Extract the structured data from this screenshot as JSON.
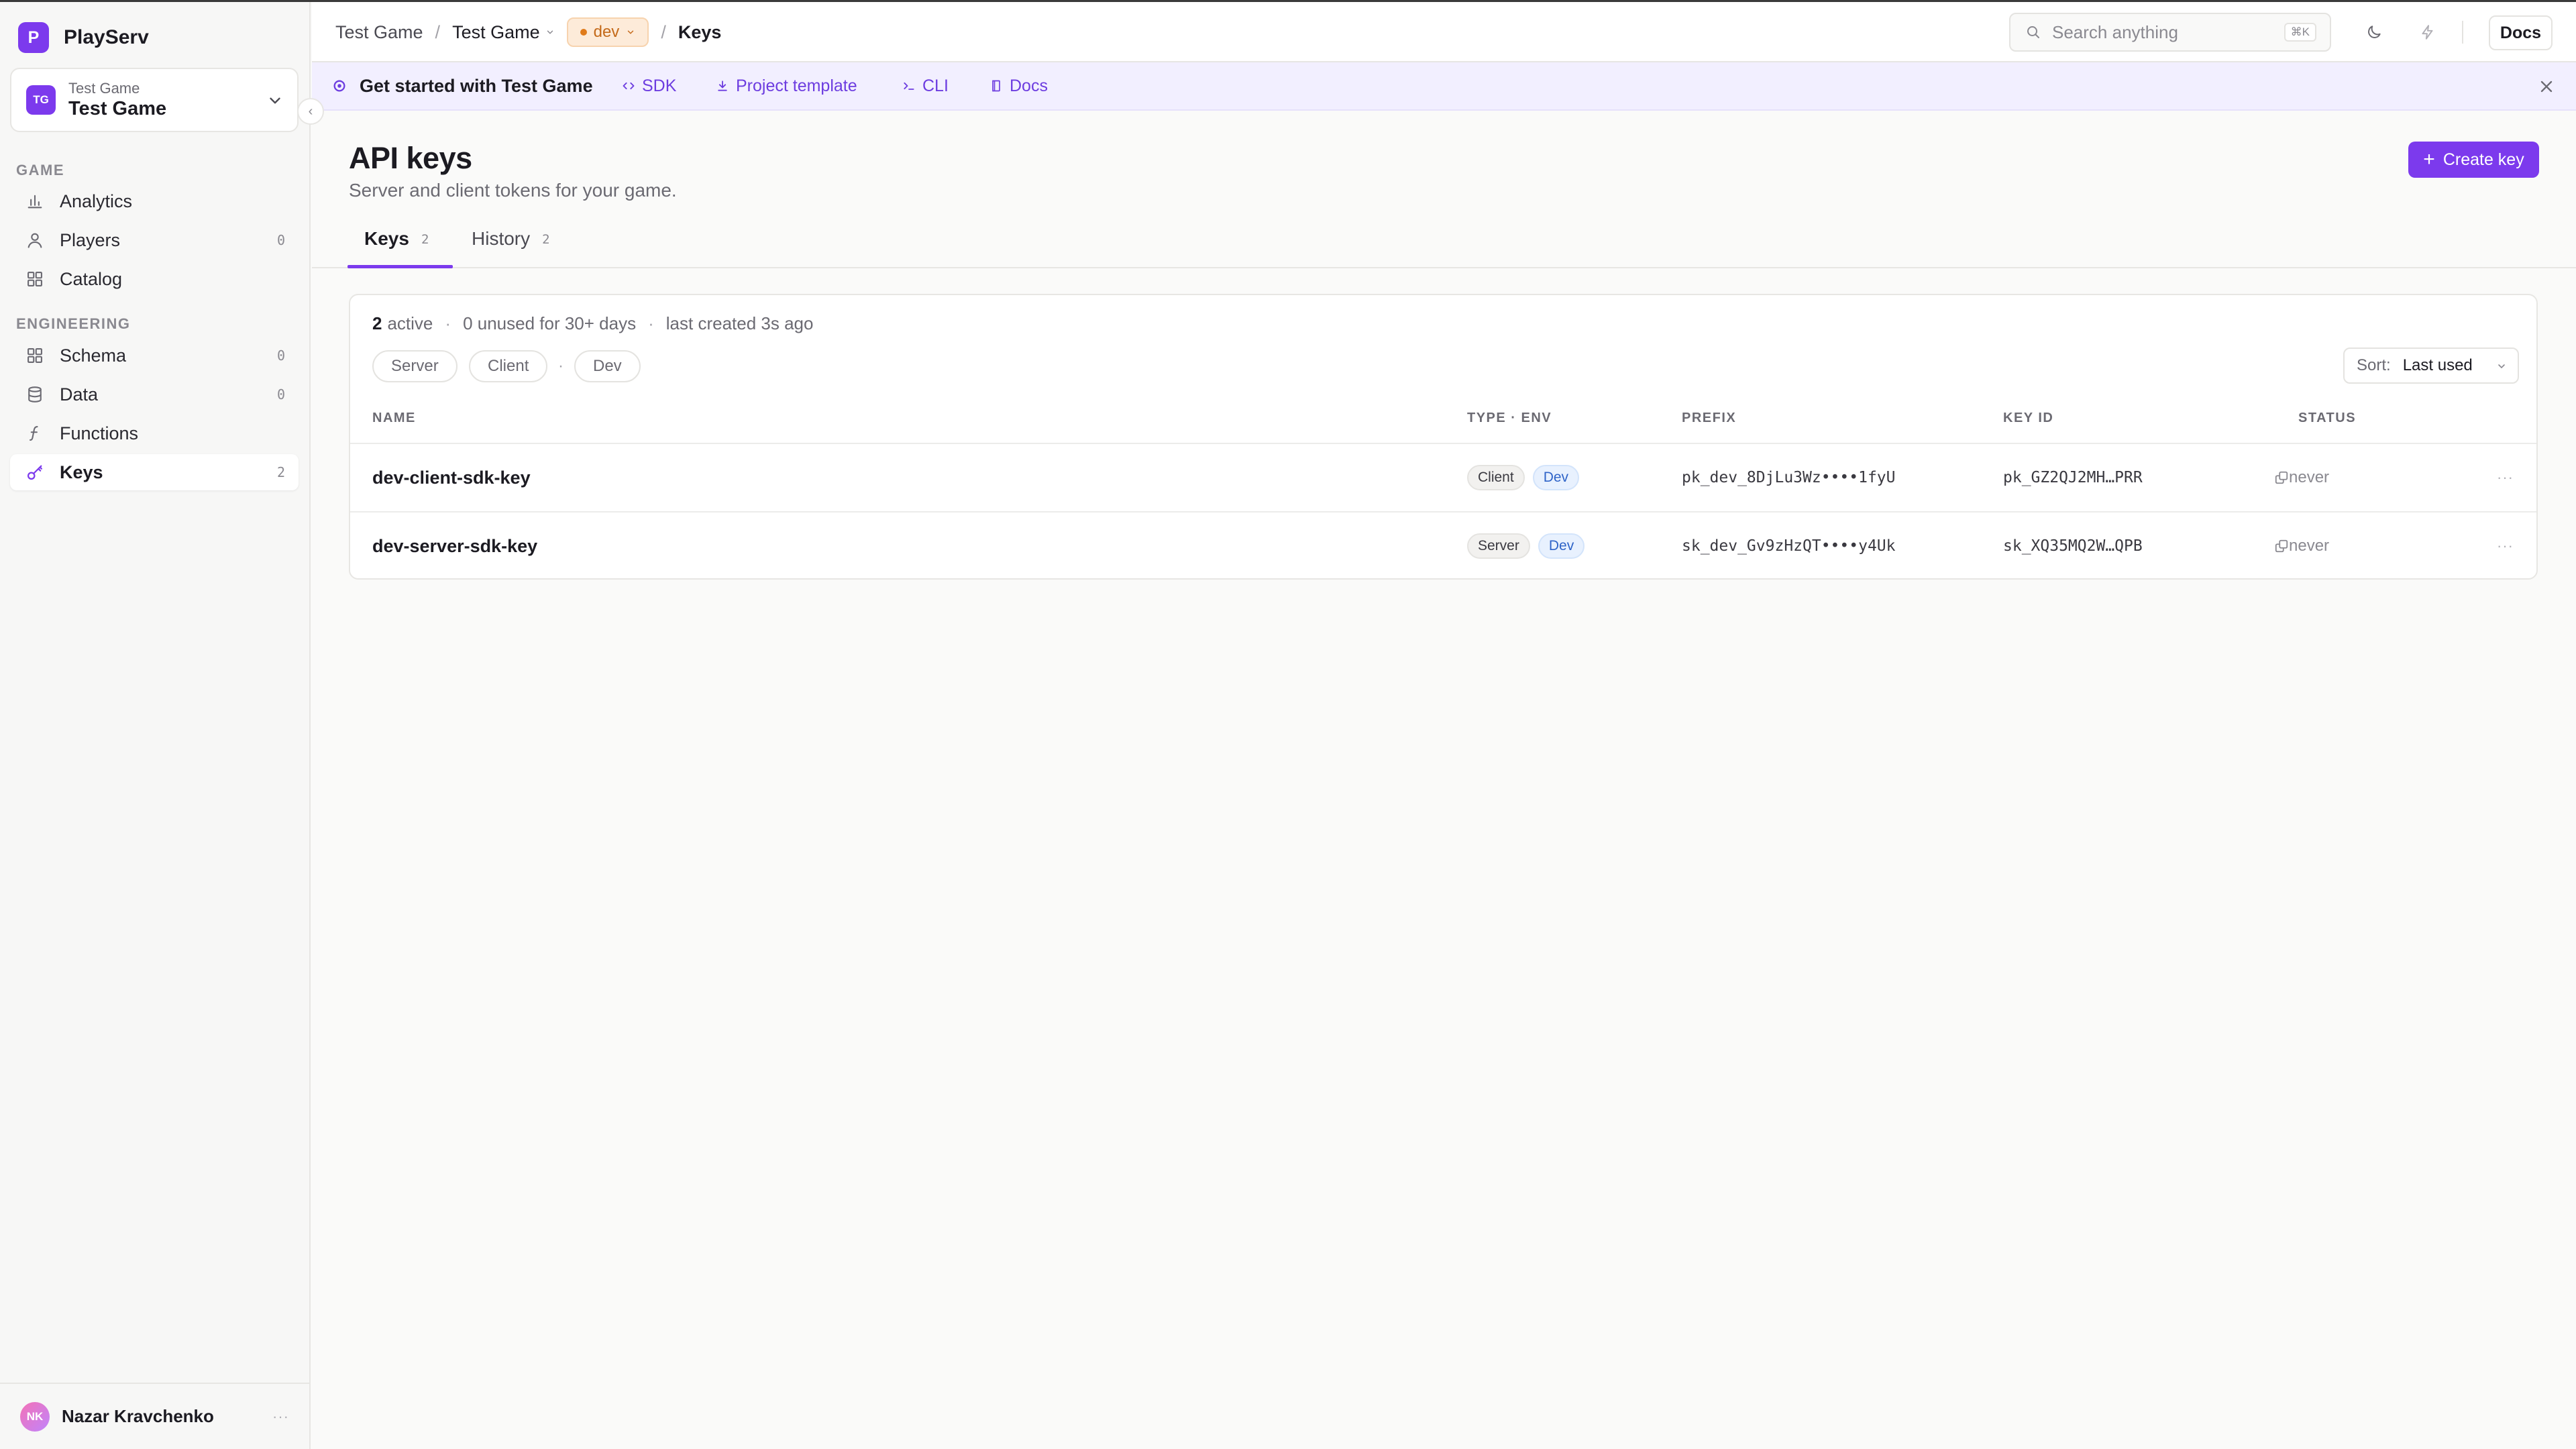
{
  "app": {
    "name": "PlayServ",
    "logo_letter": "P",
    "accent": "#7c3aed"
  },
  "project": {
    "avatar": "TG",
    "subtitle": "Test Game",
    "name": "Test Game"
  },
  "sidebar": {
    "sections": [
      {
        "label": "GAME",
        "items": [
          {
            "label": "Analytics",
            "icon": "bar-chart-icon",
            "count": ""
          },
          {
            "label": "Players",
            "icon": "user-icon",
            "count": "0"
          },
          {
            "label": "Catalog",
            "icon": "grid-icon",
            "count": ""
          }
        ]
      },
      {
        "label": "ENGINEERING",
        "items": [
          {
            "label": "Schema",
            "icon": "grid-icon",
            "count": "0"
          },
          {
            "label": "Data",
            "icon": "database-icon",
            "count": "0"
          },
          {
            "label": "Functions",
            "icon": "function-icon",
            "count": ""
          },
          {
            "label": "Keys",
            "icon": "key-icon",
            "count": "2",
            "active": true
          }
        ]
      }
    ],
    "user": {
      "initials": "NK",
      "name": "Nazar Kravchenko"
    }
  },
  "topbar": {
    "breadcrumb": [
      "Test Game",
      "Test Game",
      "dev",
      "Keys"
    ],
    "search_placeholder": "Search anything",
    "search_shortcut": "⌘K",
    "docs_label": "Docs"
  },
  "banner": {
    "title": "Get started with Test Game",
    "links": [
      "SDK",
      "Project template",
      "CLI",
      "Docs"
    ]
  },
  "page": {
    "title": "API keys",
    "subtitle": "Server and client tokens for your game.",
    "create_label": "Create key",
    "tabs": [
      {
        "label": "Keys",
        "count": "2",
        "active": true
      },
      {
        "label": "History",
        "count": "2"
      }
    ]
  },
  "keys": {
    "summary": {
      "active_count": "2",
      "active_label": "active",
      "unused": "0 unused for 30+ days",
      "last_created": "last created 3s ago"
    },
    "filters": [
      "Server",
      "Client",
      "Dev"
    ],
    "filter_separator": "·",
    "sort": {
      "label": "Sort:",
      "value": "Last used"
    },
    "columns": [
      "NAME",
      "TYPE · ENV",
      "PREFIX",
      "KEY ID",
      "STATUS"
    ],
    "rows": [
      {
        "name": "dev-client-sdk-key",
        "type": "Client",
        "env": "Dev",
        "prefix": "pk_dev_8DjLu3Wz••••1fyU",
        "key_id": "pk_GZ2QJ2MH…PRR",
        "status": "never"
      },
      {
        "name": "dev-server-sdk-key",
        "type": "Server",
        "env": "Dev",
        "prefix": "sk_dev_Gv9zHzQT••••y4Uk",
        "key_id": "sk_XQ35MQ2W…QPB",
        "status": "never"
      }
    ],
    "row_more": "···"
  }
}
